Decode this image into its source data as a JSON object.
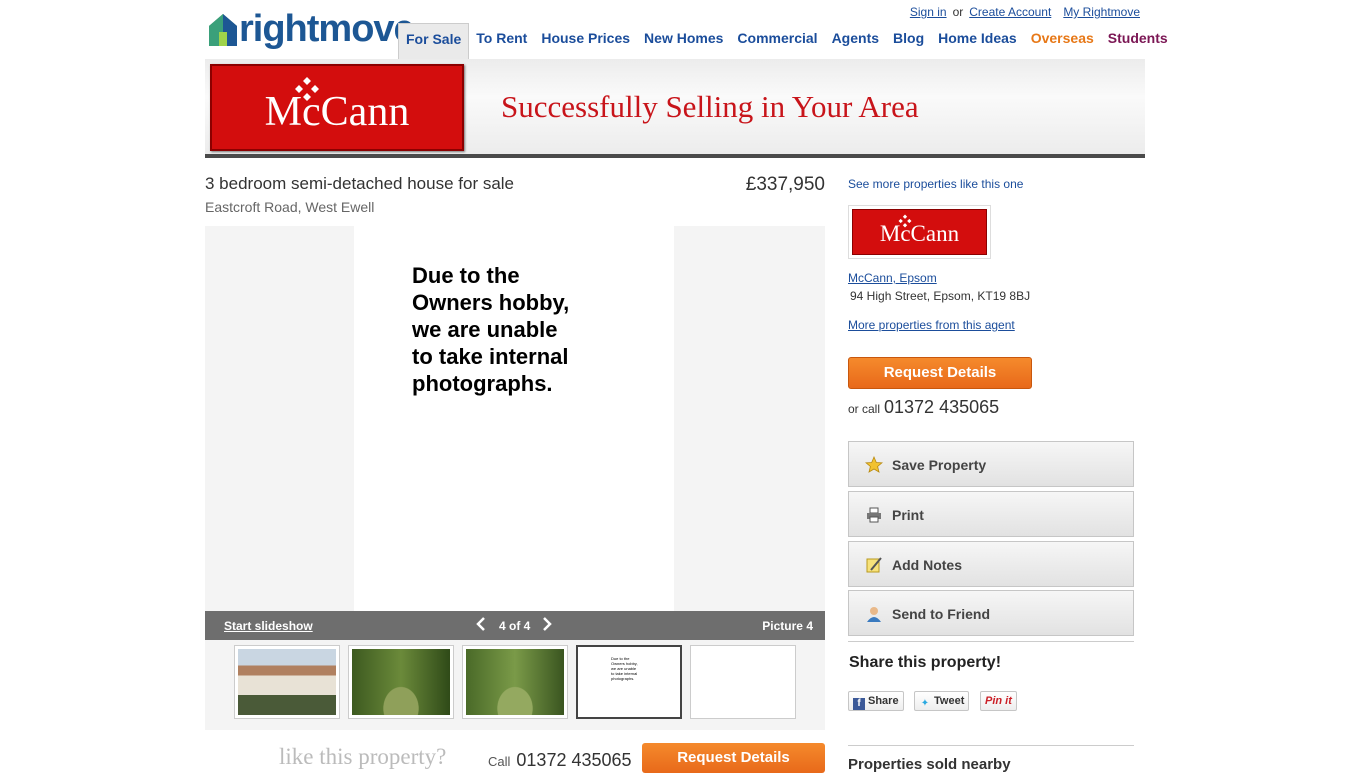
{
  "header": {
    "logo_text": "rightmove",
    "toplinks": {
      "sign_in": "Sign in",
      "or": "or",
      "create_account": "Create Account",
      "my_rightmove": "My Rightmove"
    },
    "nav": [
      "For Sale",
      "To Rent",
      "House Prices",
      "New Homes",
      "Commercial",
      "Agents",
      "Blog",
      "Home Ideas",
      "Overseas",
      "Students"
    ]
  },
  "banner": {
    "brand": "McCann",
    "tagline": "Successfully Selling in Your Area"
  },
  "property": {
    "title": "3 bedroom semi-detached house for sale",
    "address": "Eastcroft Road, West Ewell",
    "price": "£337,950"
  },
  "gallery": {
    "main_message": [
      "Due to the",
      "Owners hobby,",
      "we are unable",
      "to take internal",
      "photographs."
    ],
    "start_slideshow": "Start slideshow",
    "counter": "4 of 4",
    "picture_label": "Picture 4",
    "thumb_text": [
      "Due to the",
      "Owners hobby,",
      "we are unable",
      "to take internal",
      "photographs."
    ]
  },
  "bottom": {
    "like": "like this property?",
    "call": "Call",
    "phone": "01372 435065",
    "request": "Request Details"
  },
  "sidebar": {
    "see_more": "See more properties like this one",
    "agent_brand": "McCann",
    "agent_name": "McCann, Epsom",
    "agent_address": "94 High Street, Epsom, KT19 8BJ",
    "more_from_agent": "More properties from this agent",
    "request": "Request Details",
    "or_call": "or call",
    "phone": "01372 435065",
    "actions": {
      "save": "Save Property",
      "print": "Print",
      "notes": "Add Notes",
      "send": "Send to Friend"
    },
    "share_title": "Share this property!",
    "share": {
      "facebook": "Share",
      "twitter": "Tweet",
      "pinterest": "Pin it"
    },
    "sold_nearby": "Properties sold nearby"
  }
}
